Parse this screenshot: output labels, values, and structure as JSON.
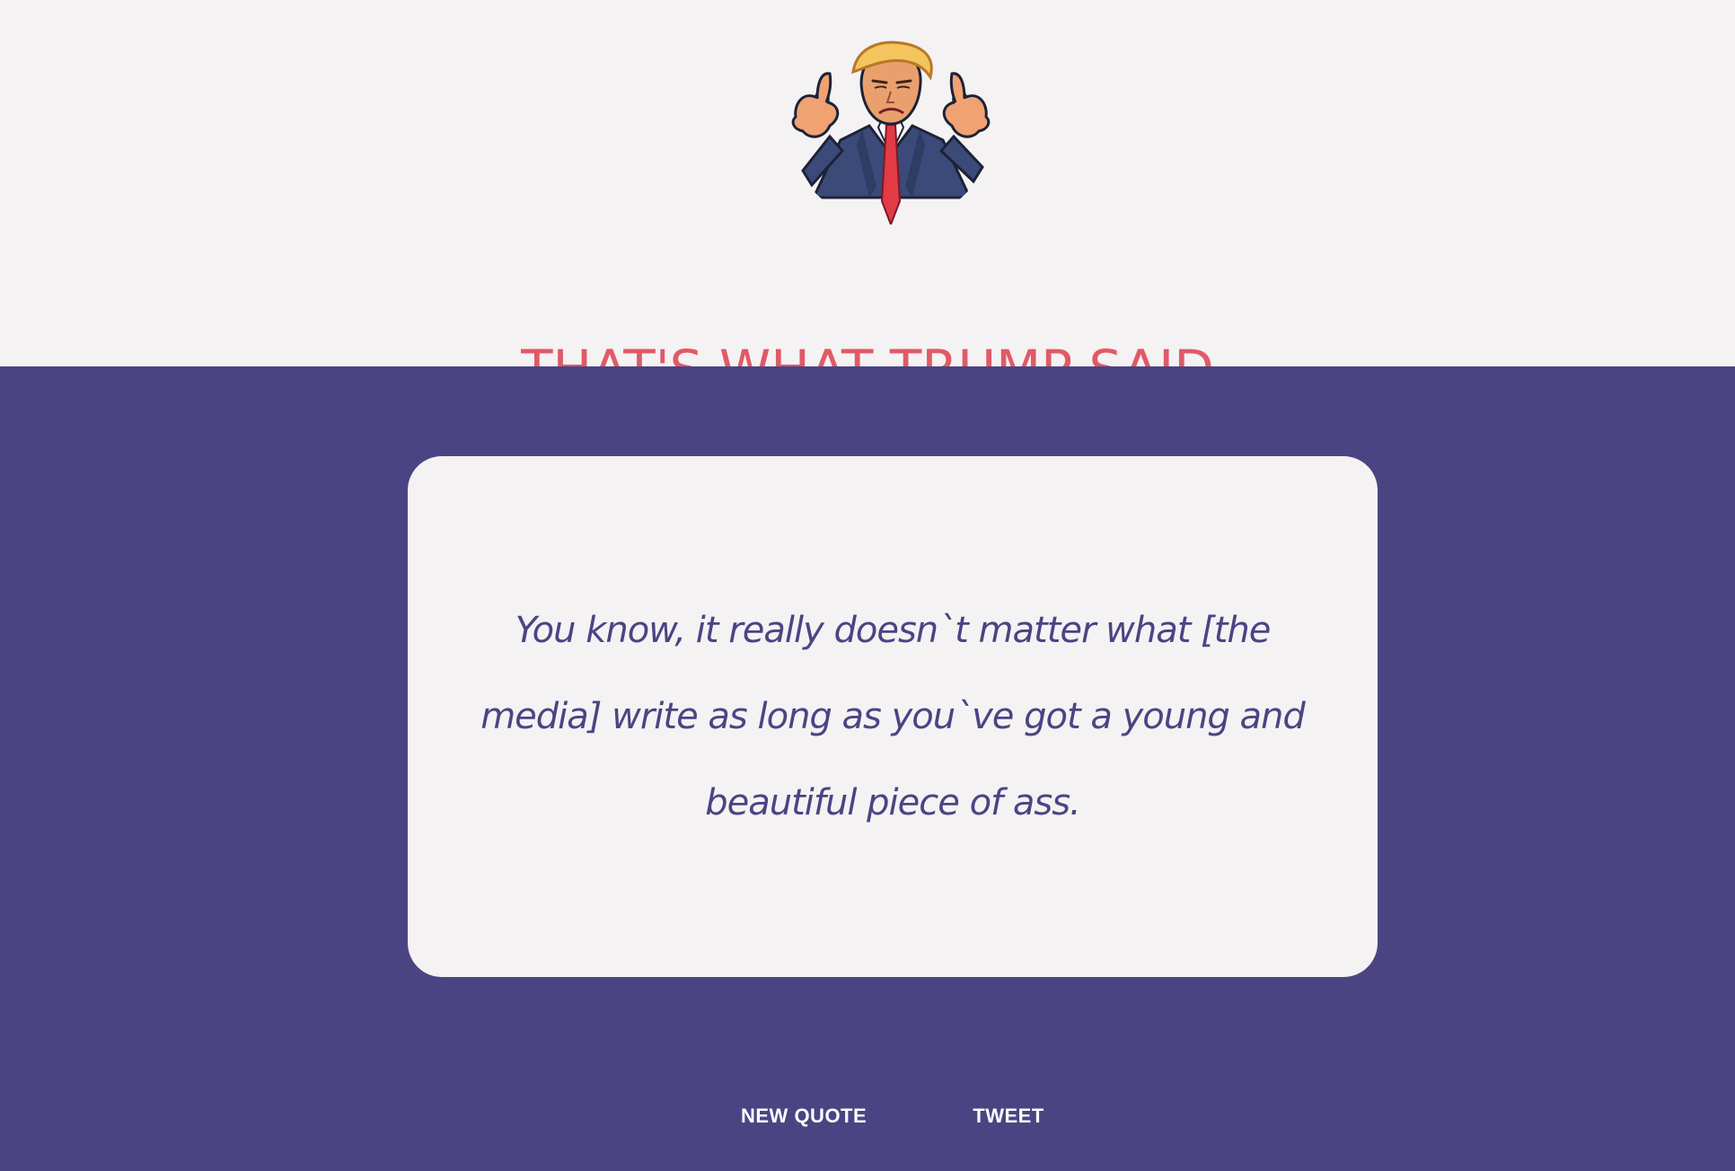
{
  "header": {
    "avatar_icon": "trump-thumbs-up-avatar-icon",
    "title": "THAT'S WHAT TRUMP SAID"
  },
  "quote": {
    "text": "You know, it really doesn`t matter what [the media] write as long as you`ve got a young and beautiful piece of ass."
  },
  "actions": {
    "new_quote_label": "NEW QUOTE",
    "tweet_label": "TWEET"
  },
  "colors": {
    "background_light": "#f4f2f3",
    "background_purple": "#4b4483",
    "title_red": "#e05a66",
    "quote_text": "#4b4483",
    "button_text": "#ffffff"
  }
}
